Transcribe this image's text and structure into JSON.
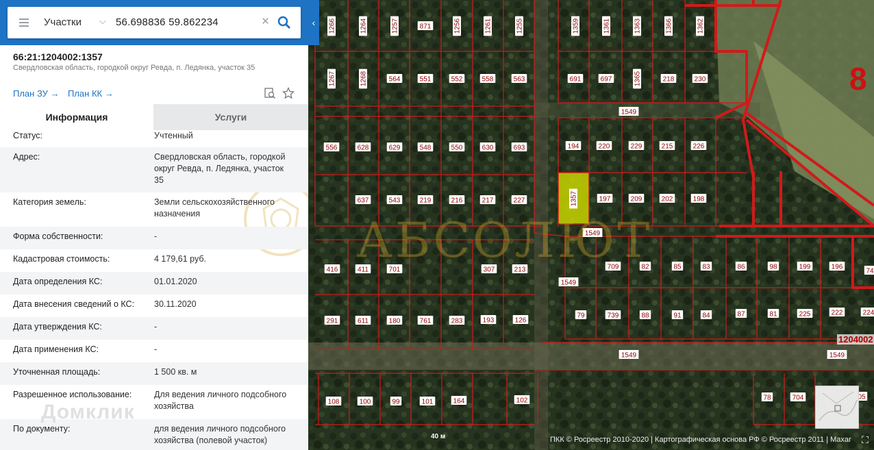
{
  "search": {
    "layer": "Участки",
    "query": "56.698836 59.862234"
  },
  "parcel": {
    "number": "66:21:1204002:1357",
    "address_short": "Свердловская область, городкой округ Ревда, п. Ледянка, участок 35"
  },
  "links": {
    "plan_zu": "План ЗУ →",
    "plan_kk": "План КК →"
  },
  "tabs": {
    "info": "Информация",
    "services": "Услуги"
  },
  "attributes": [
    {
      "key": "Статус:",
      "value": "Учтенный"
    },
    {
      "key": "Адрес:",
      "value": "Свердловская область, городкой округ Ревда, п. Ледянка, участок 35"
    },
    {
      "key": "Категория земель:",
      "value": "Земли сельскохозяйственного назначения"
    },
    {
      "key": "Форма собственности:",
      "value": "-"
    },
    {
      "key": "Кадастровая стоимость:",
      "value": "4 179,61 руб."
    },
    {
      "key": "Дата определения КС:",
      "value": "01.01.2020"
    },
    {
      "key": "Дата внесения сведений о КС:",
      "value": "30.11.2020"
    },
    {
      "key": "Дата утверждения КС:",
      "value": "-"
    },
    {
      "key": "Дата применения КС:",
      "value": "-"
    },
    {
      "key": "Уточненная площадь:",
      "value": "1 500 кв. м"
    },
    {
      "key": "Разрешенное использование:",
      "value": "Для ведения личного подсобного хозяйства"
    },
    {
      "key": "По документу:",
      "value": "для ведения личного подсобного хозяйства (полевой участок)"
    }
  ],
  "watermarks": {
    "domclick": "Домклик",
    "absolut": "АБСОЛЮТ"
  },
  "map": {
    "scale": "40 м",
    "attribution": "ПКК © Росреестр 2010-2020 | Картографическая основа РФ © Росреестр 2011 | Maxar",
    "big_label": "8",
    "code_label": "1204002",
    "selected_plot": "1357",
    "road_label": "1549",
    "plot_labels": [
      {
        "t": "1266",
        "v": true
      },
      {
        "t": "1264",
        "v": true
      },
      {
        "t": "1257",
        "v": true
      },
      {
        "t": "871",
        "v": false
      },
      {
        "t": "1256",
        "v": true
      },
      {
        "t": "1261",
        "v": true
      },
      {
        "t": "1255",
        "v": true
      },
      {
        "t": "1359",
        "v": true
      },
      {
        "t": "1361",
        "v": true
      },
      {
        "t": "1363",
        "v": true
      },
      {
        "t": "1366",
        "v": true
      },
      {
        "t": "1362",
        "v": true
      },
      {
        "t": "1267",
        "v": true
      },
      {
        "t": "1268",
        "v": true
      },
      {
        "t": "564",
        "v": false
      },
      {
        "t": "551",
        "v": false
      },
      {
        "t": "552",
        "v": false
      },
      {
        "t": "558",
        "v": false
      },
      {
        "t": "563",
        "v": false
      },
      {
        "t": "691",
        "v": false
      },
      {
        "t": "697",
        "v": false
      },
      {
        "t": "1365",
        "v": true
      },
      {
        "t": "218",
        "v": false
      },
      {
        "t": "230",
        "v": false
      },
      {
        "t": "556",
        "v": false
      },
      {
        "t": "628",
        "v": false
      },
      {
        "t": "629",
        "v": false
      },
      {
        "t": "548",
        "v": false
      },
      {
        "t": "550",
        "v": false
      },
      {
        "t": "630",
        "v": false
      },
      {
        "t": "693",
        "v": false
      },
      {
        "t": "194",
        "v": false
      },
      {
        "t": "220",
        "v": false
      },
      {
        "t": "229",
        "v": false
      },
      {
        "t": "215",
        "v": false
      },
      {
        "t": "226",
        "v": false
      },
      {
        "t": "637",
        "v": false
      },
      {
        "t": "543",
        "v": false
      },
      {
        "t": "219",
        "v": false
      },
      {
        "t": "216",
        "v": false
      },
      {
        "t": "217",
        "v": false
      },
      {
        "t": "227",
        "v": false
      },
      {
        "t": "197",
        "v": false
      },
      {
        "t": "209",
        "v": false
      },
      {
        "t": "202",
        "v": false
      },
      {
        "t": "198",
        "v": false
      },
      {
        "t": "416",
        "v": false
      },
      {
        "t": "411",
        "v": false
      },
      {
        "t": "701",
        "v": false
      },
      {
        "t": "307",
        "v": false
      },
      {
        "t": "213",
        "v": false
      },
      {
        "t": "709",
        "v": false
      },
      {
        "t": "82",
        "v": false
      },
      {
        "t": "85",
        "v": false
      },
      {
        "t": "83",
        "v": false
      },
      {
        "t": "86",
        "v": false
      },
      {
        "t": "98",
        "v": false
      },
      {
        "t": "199",
        "v": false
      },
      {
        "t": "196",
        "v": false
      },
      {
        "t": "74",
        "v": false
      },
      {
        "t": "291",
        "v": false
      },
      {
        "t": "611",
        "v": false
      },
      {
        "t": "180",
        "v": false
      },
      {
        "t": "761",
        "v": false
      },
      {
        "t": "283",
        "v": false
      },
      {
        "t": "193",
        "v": false
      },
      {
        "t": "126",
        "v": false
      },
      {
        "t": "79",
        "v": false
      },
      {
        "t": "739",
        "v": false
      },
      {
        "t": "88",
        "v": false
      },
      {
        "t": "91",
        "v": false
      },
      {
        "t": "84",
        "v": false
      },
      {
        "t": "87",
        "v": false
      },
      {
        "t": "81",
        "v": false
      },
      {
        "t": "225",
        "v": false
      },
      {
        "t": "222",
        "v": false
      },
      {
        "t": "224",
        "v": false
      },
      {
        "t": "108",
        "v": false
      },
      {
        "t": "100",
        "v": false
      },
      {
        "t": "99",
        "v": false
      },
      {
        "t": "101",
        "v": false
      },
      {
        "t": "164",
        "v": false
      },
      {
        "t": "102",
        "v": false
      },
      {
        "t": "78",
        "v": false
      },
      {
        "t": "704",
        "v": false
      },
      {
        "t": "05",
        "v": false
      }
    ]
  },
  "colors": {
    "header_blue": "#1e73c4",
    "boundary_red": "#d11a1a",
    "selected_fill": "#c8d400"
  }
}
